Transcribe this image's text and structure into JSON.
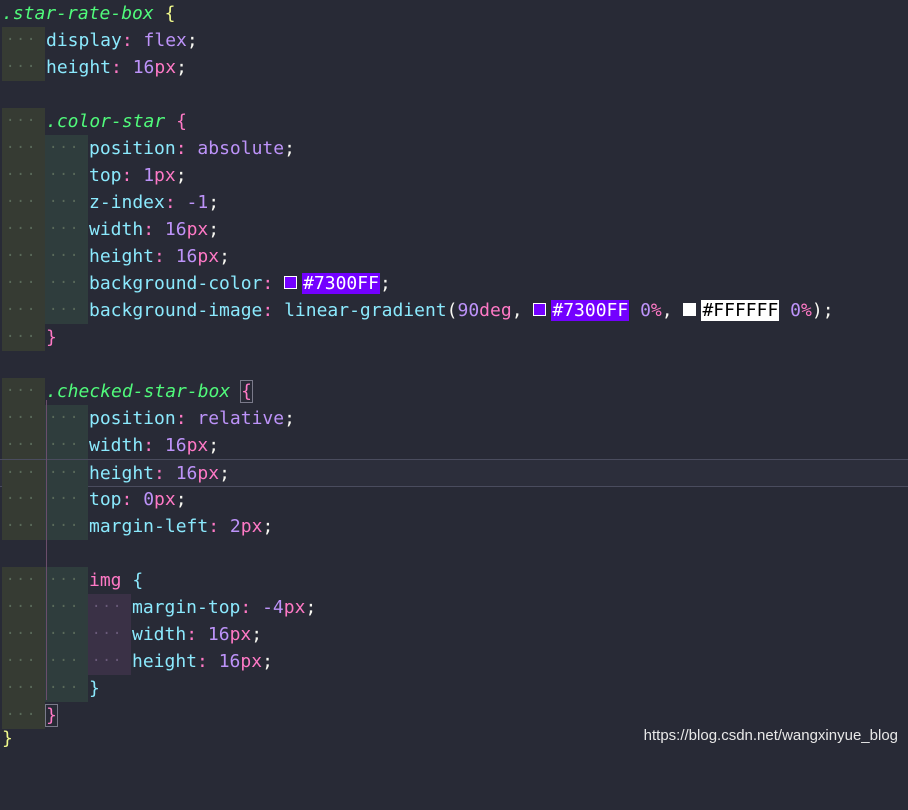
{
  "editor": {
    "lines": [
      {
        "tokens": [
          ".star-rate-box",
          " ",
          "{"
        ]
      },
      {
        "prop": "display",
        "value": "flex"
      },
      {
        "prop": "height",
        "num": "16",
        "unit": "px"
      },
      {},
      {
        "tokens": [
          ".color-star",
          " ",
          "{"
        ]
      },
      {
        "prop": "position",
        "value": "absolute"
      },
      {
        "prop": "top",
        "num": "1",
        "unit": "px"
      },
      {
        "prop": "z-index",
        "num": "-1"
      },
      {
        "prop": "width",
        "num": "16",
        "unit": "px"
      },
      {
        "prop": "height",
        "num": "16",
        "unit": "px"
      },
      {
        "prop": "background-color",
        "hex": "#7300FF"
      },
      {
        "prop": "background-image",
        "fn": "linear-gradient",
        "deg_num": "90",
        "deg_unit": "deg",
        "hex1": "#7300FF",
        "pct1": "0",
        "hex2": "#FFFFFF",
        "pct2": "0"
      },
      {
        "close": "}"
      },
      {},
      {
        "tokens": [
          ".checked-star-box",
          " ",
          "{"
        ]
      },
      {
        "prop": "position",
        "value": "relative"
      },
      {
        "prop": "width",
        "num": "16",
        "unit": "px"
      },
      {
        "prop": "height",
        "num": "16",
        "unit": "px"
      },
      {
        "prop": "top",
        "num": "0",
        "unit": "px"
      },
      {
        "prop": "margin-left",
        "num": "2",
        "unit": "px"
      },
      {},
      {
        "tokens": [
          "img",
          " ",
          "{"
        ]
      },
      {
        "prop": "margin-top",
        "num": "-4",
        "unit": "px"
      },
      {
        "prop": "width",
        "num": "16",
        "unit": "px"
      },
      {
        "prop": "height",
        "num": "16",
        "unit": "px"
      },
      {
        "close": "}"
      },
      {
        "close": "}"
      },
      {
        "close": "}"
      }
    ]
  },
  "watermark": "https://blog.csdn.net/wangxinyue_blog",
  "colors": {
    "background": "#282a36",
    "selector": "#50fa7b",
    "property": "#8be9fd",
    "keyword": "#bd93f9",
    "unit": "#ff79c6",
    "swatch_purple": "#7300FF",
    "swatch_white": "#FFFFFF"
  },
  "punct": {
    "colon": ":",
    "semicolon": ";",
    "comma": ",",
    "lparen": "(",
    "rparen": ")",
    "pct": "%",
    "dots": "···"
  }
}
